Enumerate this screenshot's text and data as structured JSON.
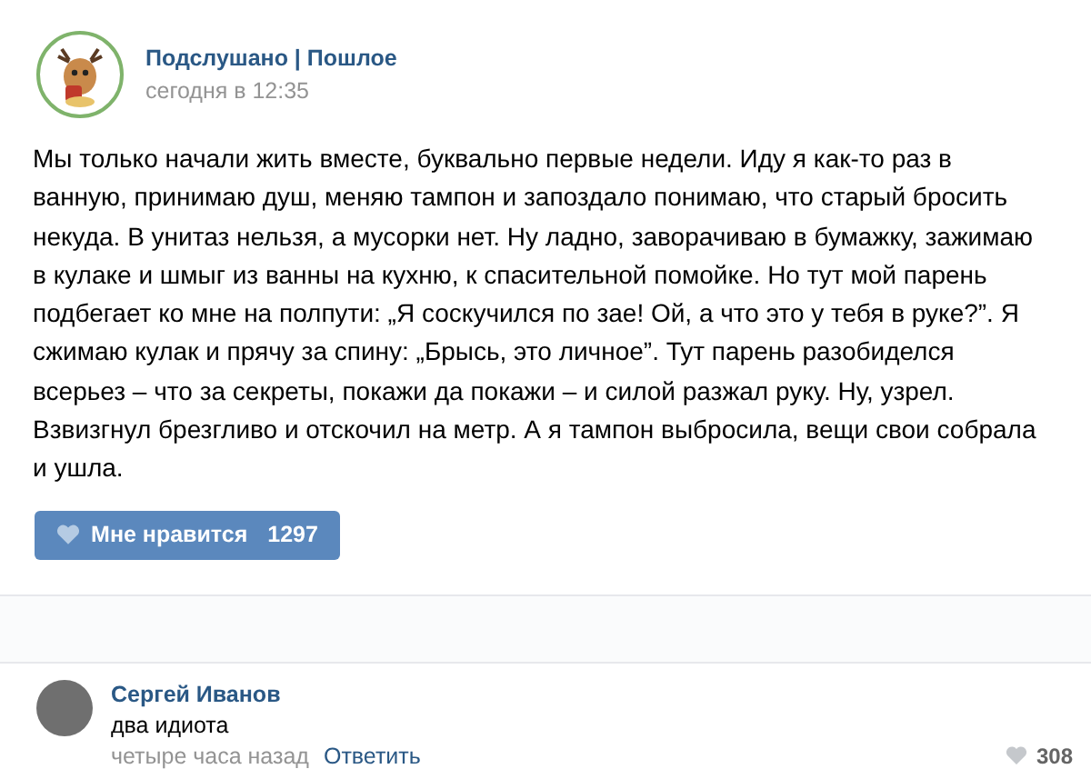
{
  "post": {
    "author": "Подслушано | Пошлое",
    "time": "сегодня в 12:35",
    "text": "Мы только начали жить вместе, буквально первые недели. Иду я как-то раз в ванную, принимаю душ, меняю тампон и запоздало понимаю, что старый бросить некуда. В унитаз нельзя, а мусорки нет. Ну ладно, заворачиваю в бумажку, зажимаю в кулаке и шмыг из ванны на кухню, к спасительной помойке. Но тут мой парень подбегает ко мне на полпути: „Я соскучился по зае! Ой, а что это у тебя в руке?”. Я сжимаю кулак и прячу за спину: „Брысь, это личное”. Тут парень разобиделся всерьез – что за секреты, покажи да покажи – и силой разжал руку. Ну, узрел. Взвизгнул брезгливо и отскочил на метр. А я тампон выбросила, вещи свои собрала и ушла.",
    "like_button": {
      "label": "Мне нравится",
      "count": "1297"
    }
  },
  "comment": {
    "author": "Сергей Иванов",
    "text": "два идиота",
    "time": "четыре часа назад",
    "reply": "Ответить",
    "likes": "308"
  }
}
